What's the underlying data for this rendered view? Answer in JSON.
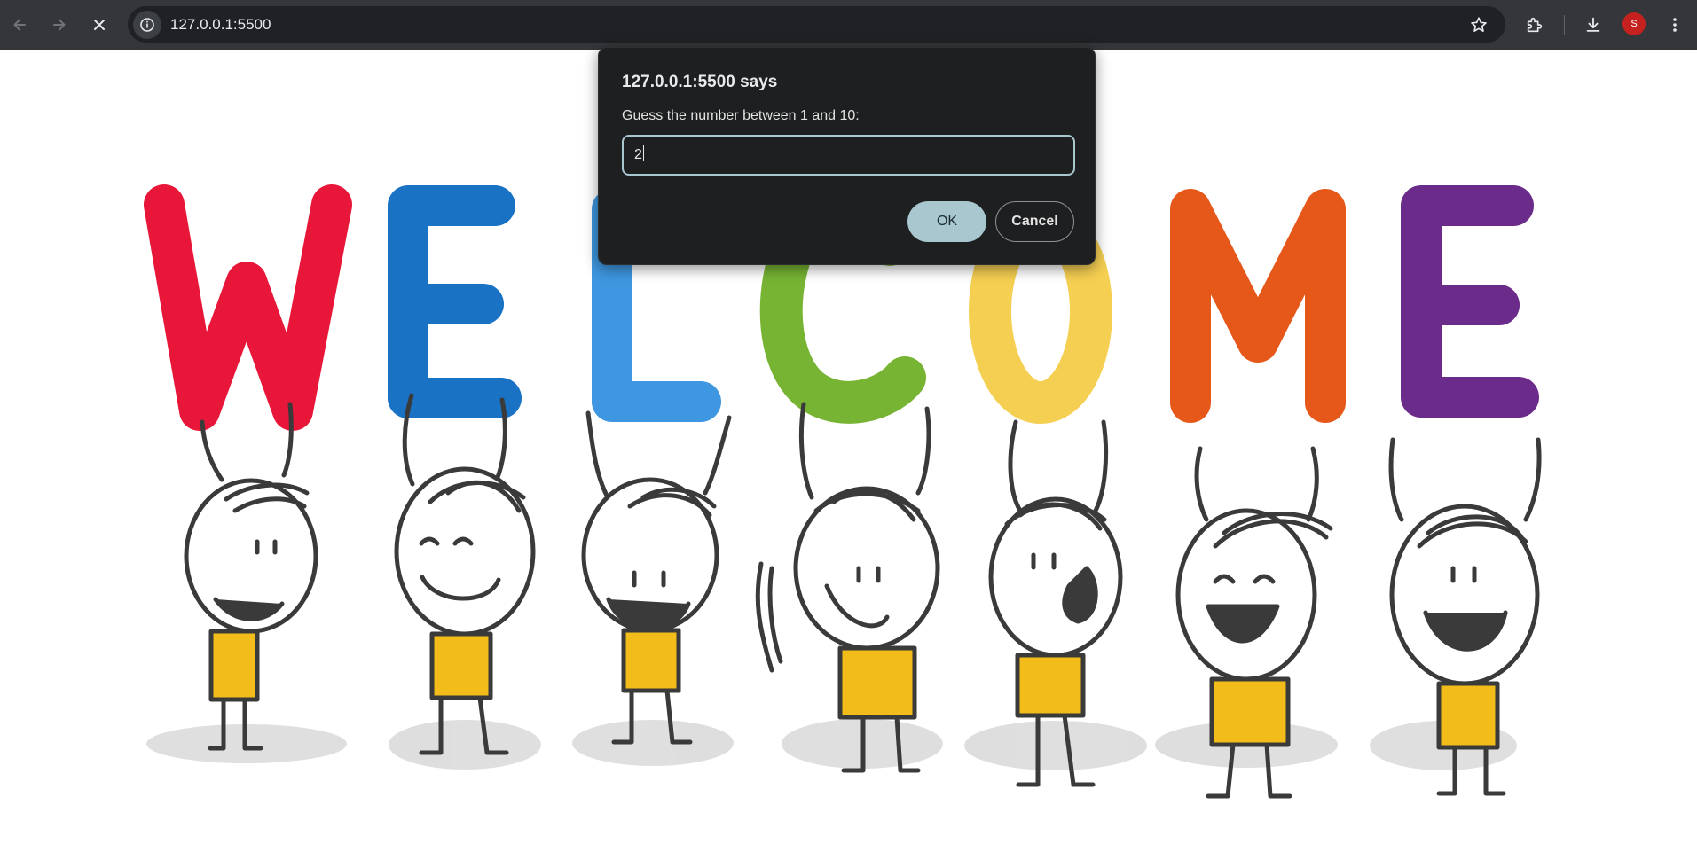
{
  "browser": {
    "url": "127.0.0.1:5500",
    "icons": [
      "back-arrow-icon",
      "forward-arrow-icon",
      "stop-loading-icon",
      "site-info-icon",
      "bookmark-star-icon",
      "extensions-puzzle-icon",
      "download-icon",
      "profile-avatar",
      "more-menu-icon"
    ],
    "avatar_letter": "S",
    "avatar_color": "#c5221f"
  },
  "page": {
    "banner_letters": [
      {
        "char": "W",
        "color": "#e8173a"
      },
      {
        "char": "E",
        "color": "#1a72c4"
      },
      {
        "char": "L",
        "color": "#3e97e0"
      },
      {
        "char": "C",
        "color": "#77b433"
      },
      {
        "char": "O",
        "color": "#f5cf52"
      },
      {
        "char": "M",
        "color": "#e5581a"
      },
      {
        "char": "E",
        "color": "#6a2b8a"
      }
    ],
    "shirt_color": "#f2bc1b"
  },
  "dialog": {
    "title": "127.0.0.1:5500 says",
    "message": "Guess the number between 1 and 10:",
    "input_value": "2",
    "ok_label": "OK",
    "cancel_label": "Cancel"
  }
}
